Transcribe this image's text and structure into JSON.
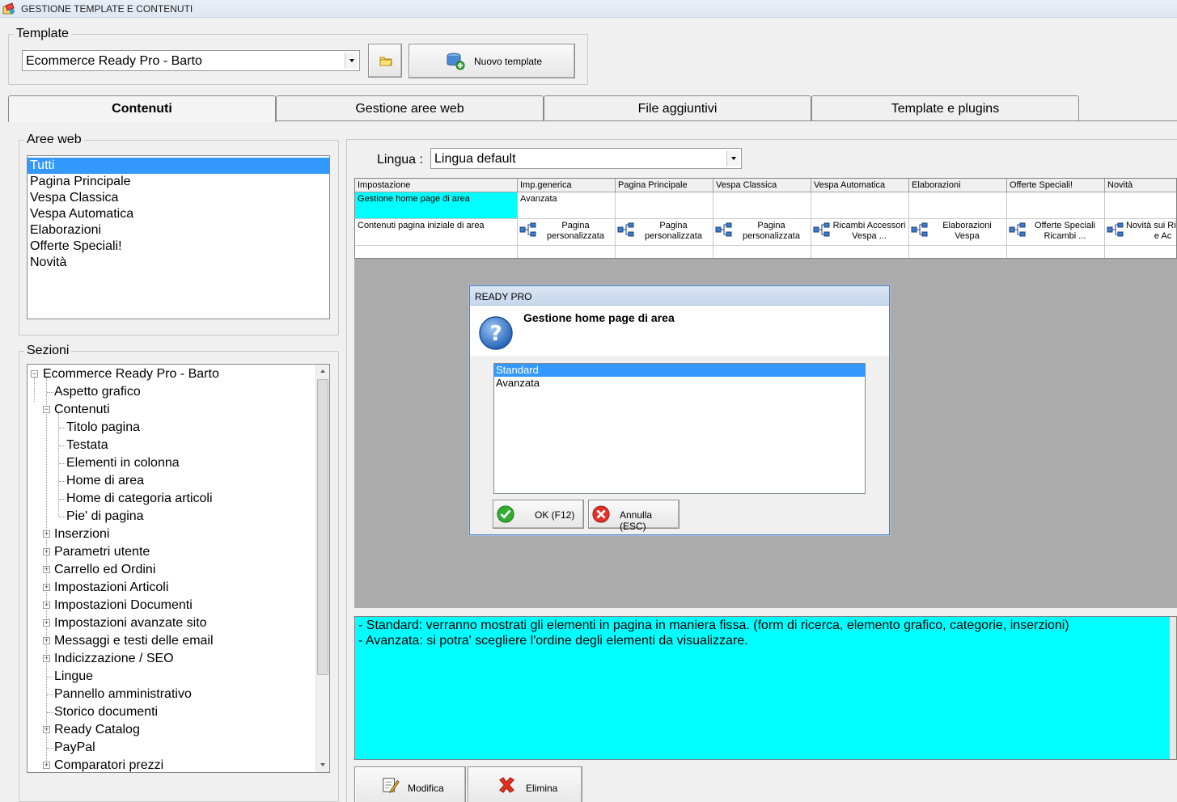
{
  "window": {
    "title": "GESTIONE TEMPLATE E CONTENUTI"
  },
  "template": {
    "legend": "Template",
    "selected": "Ecommerce Ready Pro - Barto",
    "new_button": "Nuovo template"
  },
  "tabs": [
    {
      "label": "Contenuti",
      "active": true
    },
    {
      "label": "Gestione aree web"
    },
    {
      "label": "File aggiuntivi"
    },
    {
      "label": "Template e plugins"
    }
  ],
  "aree_web": {
    "legend": "Aree web",
    "items": [
      "Tutti",
      "Pagina Principale",
      "Vespa Classica",
      "Vespa Automatica",
      "Elaborazioni",
      "Offerte Speciali!",
      "Novità"
    ],
    "selected_index": 0
  },
  "sezioni": {
    "legend": "Sezioni",
    "nodes": [
      {
        "label": "Ecommerce Ready Pro - Barto",
        "level": 0,
        "exp": "−"
      },
      {
        "label": "Aspetto grafico",
        "level": 1
      },
      {
        "label": "Contenuti",
        "level": 1,
        "exp": "−"
      },
      {
        "label": "Titolo pagina",
        "level": 2
      },
      {
        "label": "Testata",
        "level": 2
      },
      {
        "label": "Elementi in colonna",
        "level": 2
      },
      {
        "label": "Home di area",
        "level": 2
      },
      {
        "label": "Home di categoria articoli",
        "level": 2
      },
      {
        "label": "Pie' di pagina",
        "level": 2
      },
      {
        "label": "Inserzioni",
        "level": 1,
        "exp": "+"
      },
      {
        "label": "Parametri utente",
        "level": 1,
        "exp": "+"
      },
      {
        "label": "Carrello ed Ordini",
        "level": 1,
        "exp": "+"
      },
      {
        "label": "Impostazioni Articoli",
        "level": 1,
        "exp": "+"
      },
      {
        "label": "Impostazioni Documenti",
        "level": 1,
        "exp": "+"
      },
      {
        "label": "Impostazioni avanzate sito",
        "level": 1,
        "exp": "+"
      },
      {
        "label": "Messaggi e testi delle email",
        "level": 1,
        "exp": "+"
      },
      {
        "label": "Indicizzazione / SEO",
        "level": 1,
        "exp": "+"
      },
      {
        "label": "Lingue",
        "level": 1
      },
      {
        "label": "Pannello amministrativo",
        "level": 1
      },
      {
        "label": "Storico documenti",
        "level": 1
      },
      {
        "label": "Ready Catalog",
        "level": 1,
        "exp": "+"
      },
      {
        "label": "PayPal",
        "level": 1
      },
      {
        "label": "Comparatori prezzi",
        "level": 1,
        "exp": "+"
      }
    ]
  },
  "lingua": {
    "label": "Lingua :",
    "selected": "Lingua default"
  },
  "grid": {
    "headers": [
      "Impostazione",
      "Imp.generica",
      "Pagina Principale",
      "Vespa Classica",
      "Vespa Automatica",
      "Elaborazioni",
      "Offerte Speciali!",
      "Novità"
    ],
    "row1": {
      "label": "Gestione home page di area",
      "values": [
        "Avanzata",
        "",
        "",
        "",
        "",
        "",
        ""
      ]
    },
    "row2": {
      "label": "Contenuti pagina iniziale di area",
      "values": [
        "Pagina personalizzata",
        "Pagina personalizzata",
        "Pagina personalizzata",
        "Ricambi Accessori Vespa ...",
        "Elaborazioni Vespa",
        "Offerte Speciali Ricambi ...",
        "Novità sui Ricambi e Ac"
      ]
    }
  },
  "info": {
    "lines": [
      "- Standard: verranno mostrati gli elementi in pagina in maniera fissa. (form di ricerca, elemento grafico, categorie, inserzioni)",
      "- Avanzata: si potra' scegliere l'ordine degli elementi da visualizzare."
    ]
  },
  "bottom_buttons": {
    "modifica": "Modifica",
    "elimina": "Elimina"
  },
  "dialog": {
    "title": "READY PRO",
    "message": "Gestione home page di area",
    "options": [
      "Standard",
      "Avanzata"
    ],
    "selected_index": 0,
    "ok": "OK (F12)",
    "cancel": "Annulla (ESC)"
  },
  "colors": {
    "selection": "#3399ff",
    "info_bg": "#00ffff",
    "canvas_bg": "#ababab"
  }
}
